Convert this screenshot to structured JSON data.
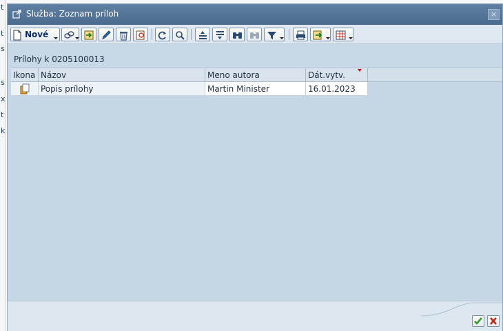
{
  "dialog": {
    "title": "Služba: Zoznam príloh",
    "close_glyph": "×"
  },
  "toolbar": {
    "new_label": "Nové",
    "buttons": [
      "new-dropdown-button",
      "link-attachment-button",
      "import-button",
      "edit-button",
      "delete-button",
      "display-attachment-button",
      "refresh-button",
      "details-button",
      "sort-ascending-button",
      "sort-descending-button",
      "find-button",
      "find-next-button",
      "filter-button",
      "print-button",
      "export-button",
      "layout-button"
    ]
  },
  "caption": "Prílohy k 0205100013",
  "table": {
    "columns": [
      "Ikona",
      "Názov",
      "Meno autora",
      "Dát.vytv."
    ],
    "sorted_column": "Dát.vytv.",
    "rows": [
      {
        "icon": "copy-document-icon",
        "name": "Popis prílohy",
        "author": "Martin Minister",
        "date": "16.01.2023"
      }
    ]
  },
  "background": {
    "left_edge_chars": [
      "t",
      "t",
      "s",
      "s",
      "x",
      "t",
      "k"
    ]
  },
  "footer": {
    "confirm_icon": "green-check-icon",
    "cancel_icon": "red-x-icon"
  },
  "colors": {
    "title_bar": "#4f6f94",
    "content_bg": "#c9d8e6",
    "sort_indicator": "#d0021b",
    "confirm": "#3a9a2a",
    "cancel": "#c8261a"
  }
}
